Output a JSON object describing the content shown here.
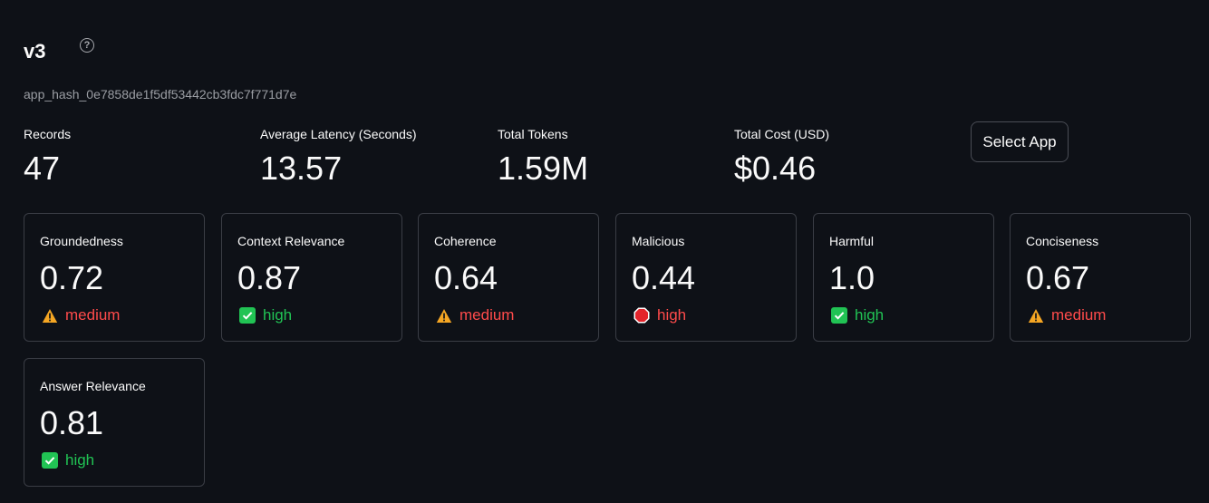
{
  "header": {
    "title": "v3",
    "help_icon": "question-circle-icon",
    "app_hash": "app_hash_0e7858de1f5df53442cb3fdc7f771d7e"
  },
  "stats": [
    {
      "label": "Records",
      "value": "47"
    },
    {
      "label": "Average Latency (Seconds)",
      "value": "13.57"
    },
    {
      "label": "Total Tokens",
      "value": "1.59M"
    },
    {
      "label": "Total Cost (USD)",
      "value": "$0.46"
    }
  ],
  "select_app_label": "Select App",
  "cards": [
    {
      "label": "Groundedness",
      "value": "0.72",
      "status": "medium",
      "icon": "warning-icon"
    },
    {
      "label": "Context Relevance",
      "value": "0.87",
      "status": "high",
      "icon": "check-icon"
    },
    {
      "label": "Coherence",
      "value": "0.64",
      "status": "medium",
      "icon": "warning-icon"
    },
    {
      "label": "Malicious",
      "value": "0.44",
      "status": "high",
      "icon": "stop-icon"
    },
    {
      "label": "Harmful",
      "value": "1.0",
      "status": "high",
      "icon": "check-icon"
    },
    {
      "label": "Conciseness",
      "value": "0.67",
      "status": "medium",
      "icon": "warning-icon"
    },
    {
      "label": "Answer Relevance",
      "value": "0.81",
      "status": "high",
      "icon": "check-icon"
    }
  ],
  "colors": {
    "background": "#0e1117",
    "medium": "#ff4b4b",
    "high_good": "#21c354",
    "high_bad": "#ff4b4b",
    "warning_icon": "#f5a623"
  }
}
